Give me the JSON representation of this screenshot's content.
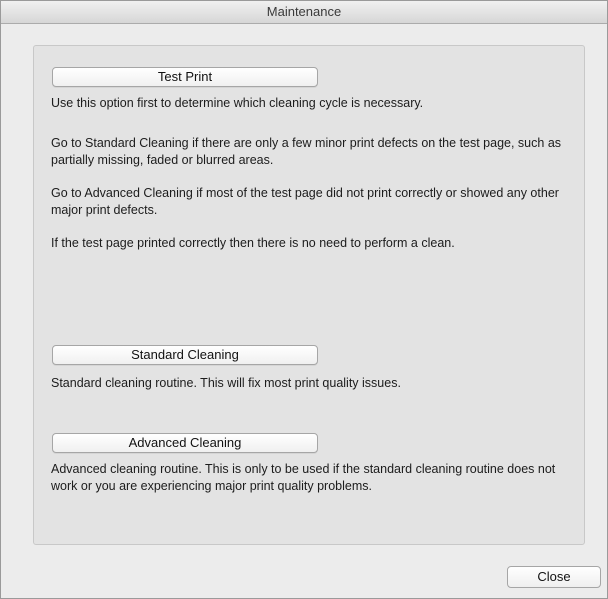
{
  "window": {
    "title": "Maintenance"
  },
  "test_print": {
    "button_label": "Test Print",
    "paragraphs": [
      "Use this option first to determine which cleaning cycle is necessary.",
      "Go to Standard Cleaning if there are only a few minor print defects on the test page, such as partially missing, faded or blurred areas.",
      "Go to Advanced Cleaning if most of the test page did not print correctly or showed any other major print defects.",
      "If the test page printed correctly then there is no need to perform a clean."
    ]
  },
  "standard_cleaning": {
    "button_label": "Standard Cleaning",
    "description": "Standard cleaning routine. This will fix most print quality issues."
  },
  "advanced_cleaning": {
    "button_label": "Advanced Cleaning",
    "description": "Advanced cleaning routine. This is only to be used if the standard cleaning routine does not work or you are experiencing major print quality problems."
  },
  "footer": {
    "close_label": "Close"
  }
}
